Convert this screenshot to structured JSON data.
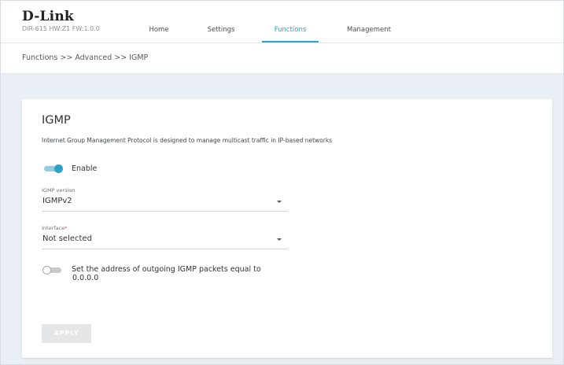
{
  "brand": {
    "logo": "D-Link",
    "model_info": "DIR-615 HW:Z1  FW:1.0.0"
  },
  "nav": {
    "items": [
      {
        "label": "Home"
      },
      {
        "label": "Settings"
      },
      {
        "label": "Functions",
        "active": true
      },
      {
        "label": "Management"
      }
    ]
  },
  "breadcrumb": "Functions >> Advanced >> IGMP",
  "card": {
    "title": "IGMP",
    "description": "Internet Group Management Protocol is designed to manage multicast traffic in IP-based networks",
    "enable": {
      "label": "Enable",
      "on": true
    },
    "igmp_version": {
      "label": "IGMP version",
      "value": "IGMPv2"
    },
    "interface": {
      "label": "Interface",
      "required_mark": "*",
      "value": "Not selected"
    },
    "outgoing_address": {
      "line1": "Set the address of outgoing IGMP packets equal to",
      "line2": "0.0.0.0",
      "on": false
    },
    "apply_label": "APPLY"
  },
  "colors": {
    "accent": "#2aa1c6",
    "background": "#e9eff4",
    "required": "#e0402d"
  }
}
